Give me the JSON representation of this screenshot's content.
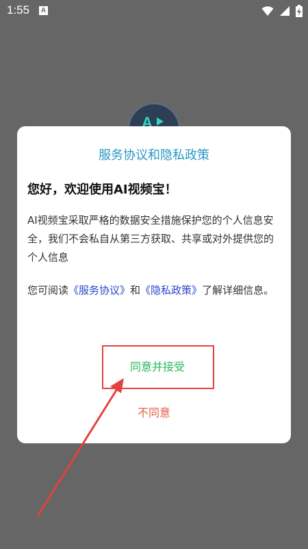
{
  "status_bar": {
    "time": "1:55",
    "notification_letter": "A"
  },
  "app_logo": {
    "text": "A"
  },
  "dialog": {
    "title": "服务协议和隐私政策",
    "greeting": "您好，欢迎使用AI视频宝！",
    "intro": "AI视频宝采取严格的数据安全措施保护您的个人信息安全，我们不会私自从第三方获取、共享或对外提供您的个人信息",
    "read_prefix": "您可阅读",
    "service_link": "《服务协议》",
    "read_and": "和",
    "privacy_link": "《隐私政策》",
    "read_suffix": "了解详细信息。",
    "agree_label": "同意并接受",
    "disagree_label": "不同意"
  },
  "colors": {
    "background": "#666666",
    "title": "#2996c7",
    "link": "#2a45c9",
    "agree": "#2ab55a",
    "disagree": "#e45b45",
    "annotation": "#e5403f"
  }
}
